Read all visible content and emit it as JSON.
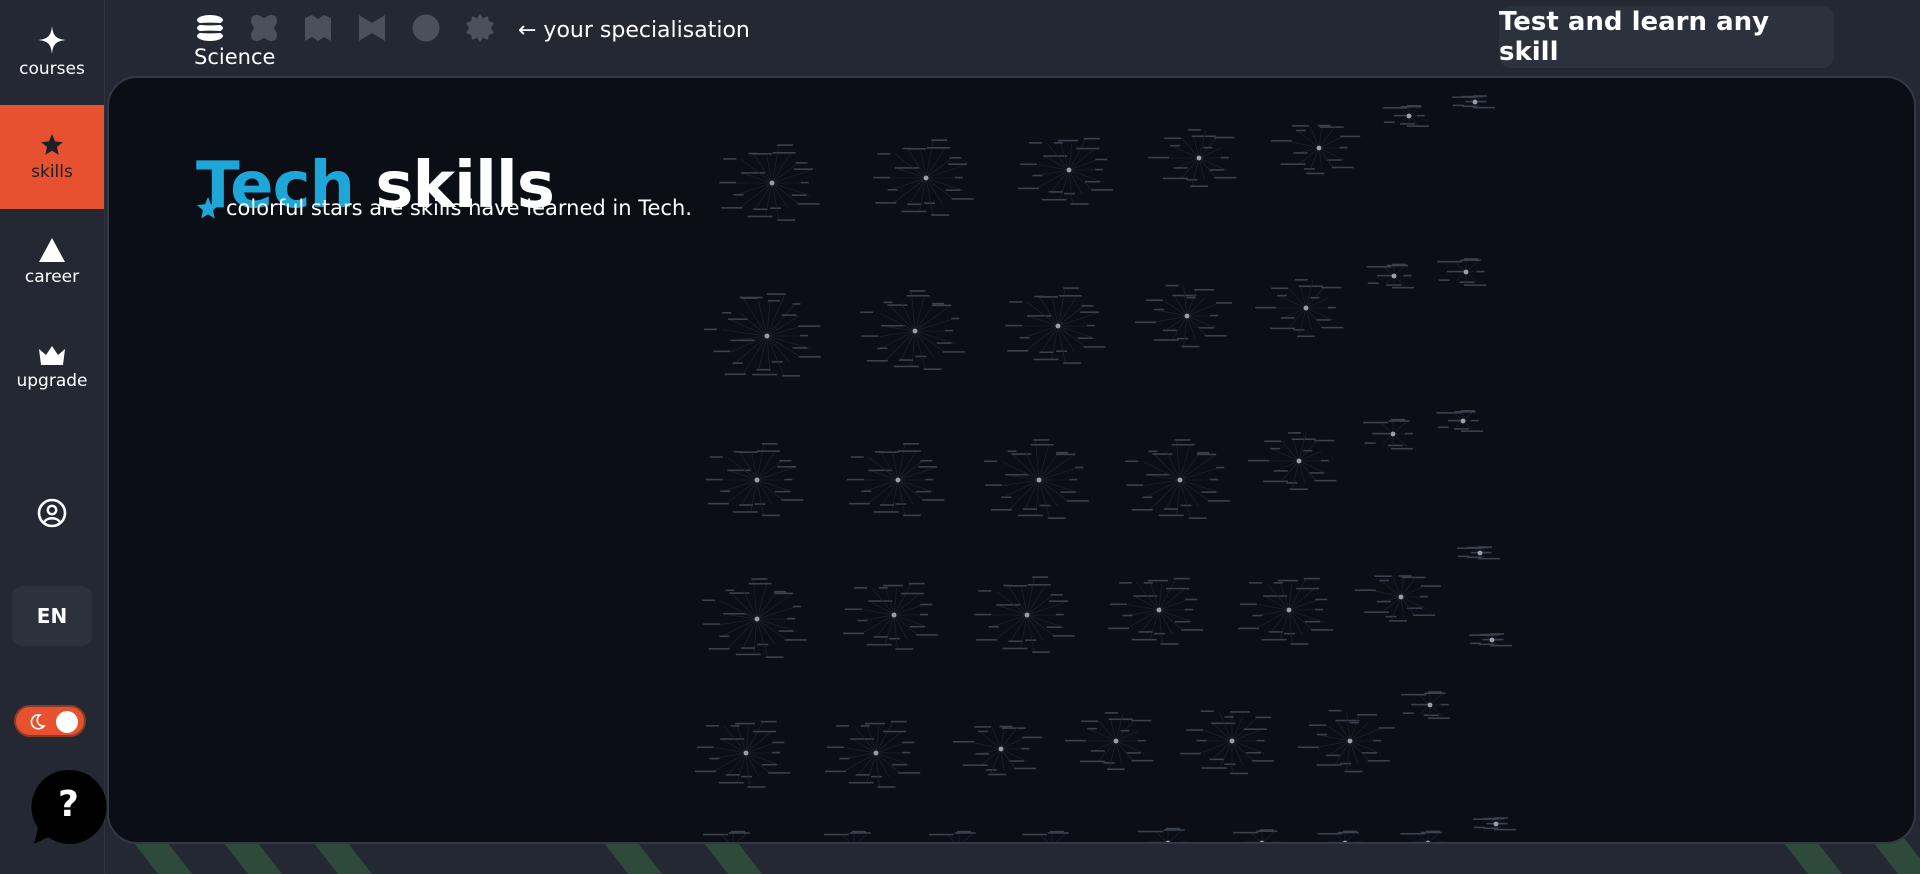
{
  "sidebar": {
    "items": [
      {
        "label": "courses",
        "icon": "sparkle-icon"
      },
      {
        "label": "skills",
        "icon": "star-icon"
      },
      {
        "label": "career",
        "icon": "triangle-icon"
      },
      {
        "label": "upgrade",
        "icon": "crown-icon"
      }
    ],
    "active": "skills",
    "language": "EN",
    "profile_icon": "user-circle-icon",
    "theme_icon": "moon-icon",
    "help_label": "?"
  },
  "topbar": {
    "specialisation_icons": [
      "layers-icon",
      "blob-icon",
      "map-icon",
      "bowtie-icon",
      "circle-icon",
      "gear-icon"
    ],
    "specialisation_hint": "← your specialisation",
    "specialisation_label": "Science",
    "cta_label": "Test and learn any skill"
  },
  "main": {
    "title_accent": "Tech",
    "title_rest": " skills",
    "subtitle": "colorful stars are skills have learned in Tech."
  },
  "colors": {
    "accent_orange": "#e8512f",
    "accent_blue": "#1fa6d9",
    "panel_bg": "#0b0e15",
    "app_bg": "#232833"
  }
}
